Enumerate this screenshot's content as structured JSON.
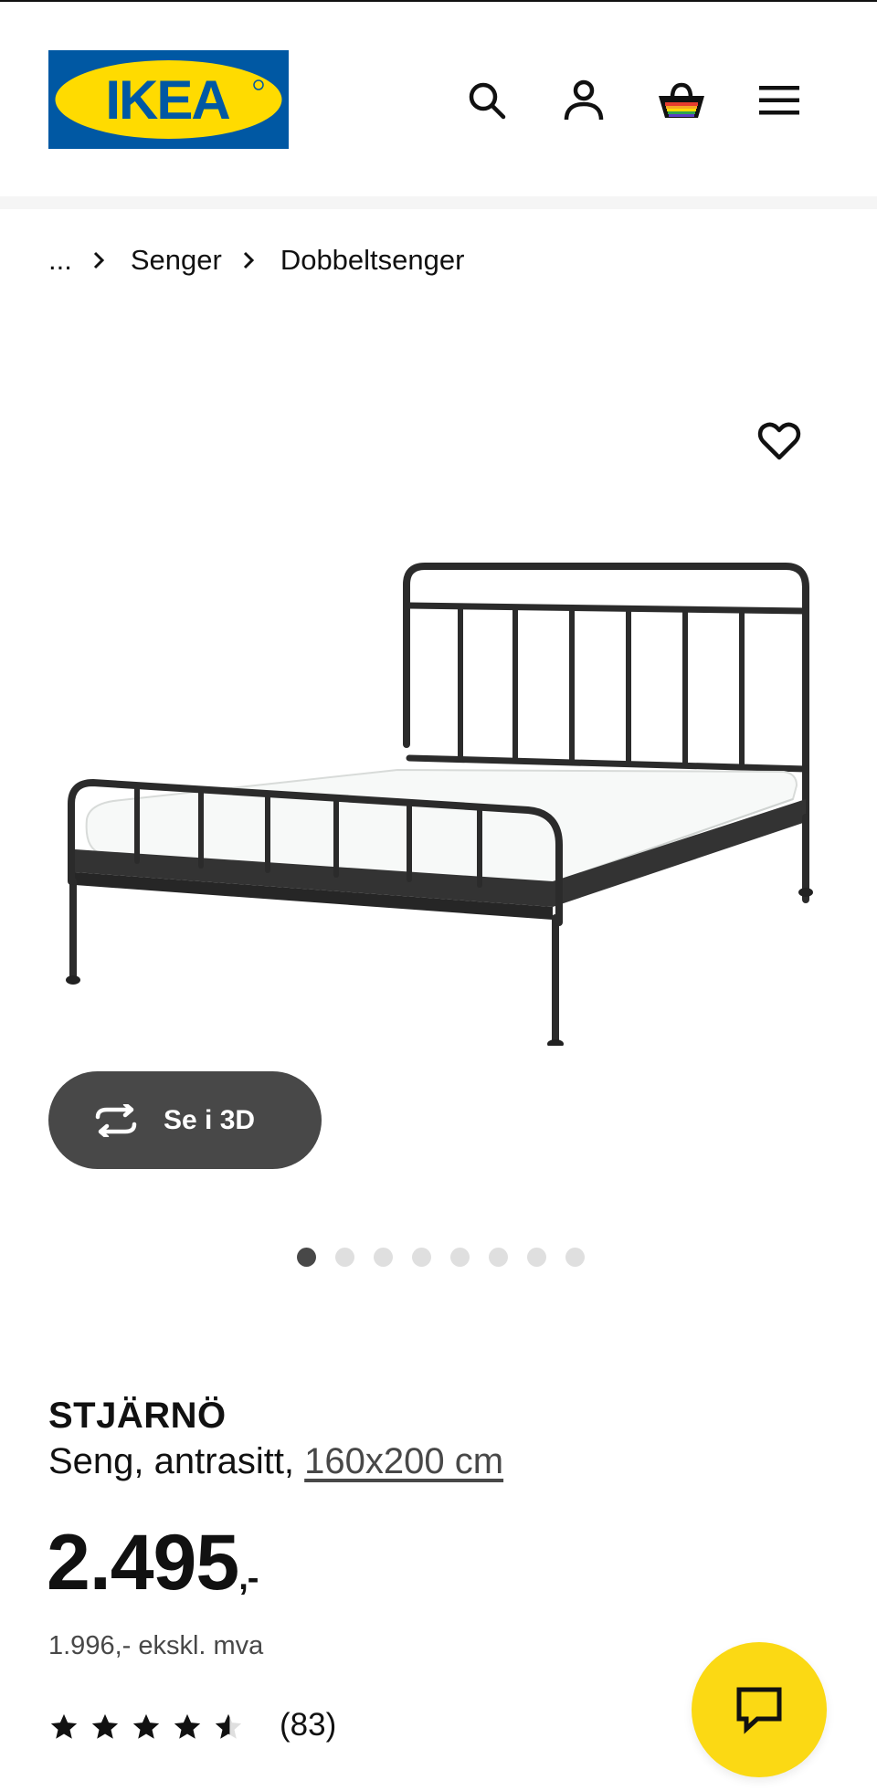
{
  "brand": {
    "logo_text": "IKEA",
    "colors": {
      "blue": "#0058a3",
      "yellow": "#ffdb00"
    }
  },
  "header": {
    "icons": [
      "search-icon",
      "account-icon",
      "basket-icon",
      "menu-icon"
    ]
  },
  "breadcrumb": {
    "ellipsis": "...",
    "items": [
      "Senger",
      "Dobbeltsenger"
    ]
  },
  "gallery": {
    "view_3d_label": "Se i 3D",
    "image_count": 8,
    "active_index": 0
  },
  "product": {
    "name": "STJÄRNÖ",
    "description_prefix": "Seng, antrasitt, ",
    "size_link": "160x200 cm",
    "price_integer": "2.495",
    "price_suffix": ",-",
    "price_ex_vat": "1.996,- ekskl. mva",
    "rating": 4.5,
    "rating_max": 5,
    "review_count": "(83)"
  },
  "colors": {
    "chat_button": "#fbd914",
    "dark_button": "#484848",
    "dot_inactive": "#dfdfdf"
  }
}
